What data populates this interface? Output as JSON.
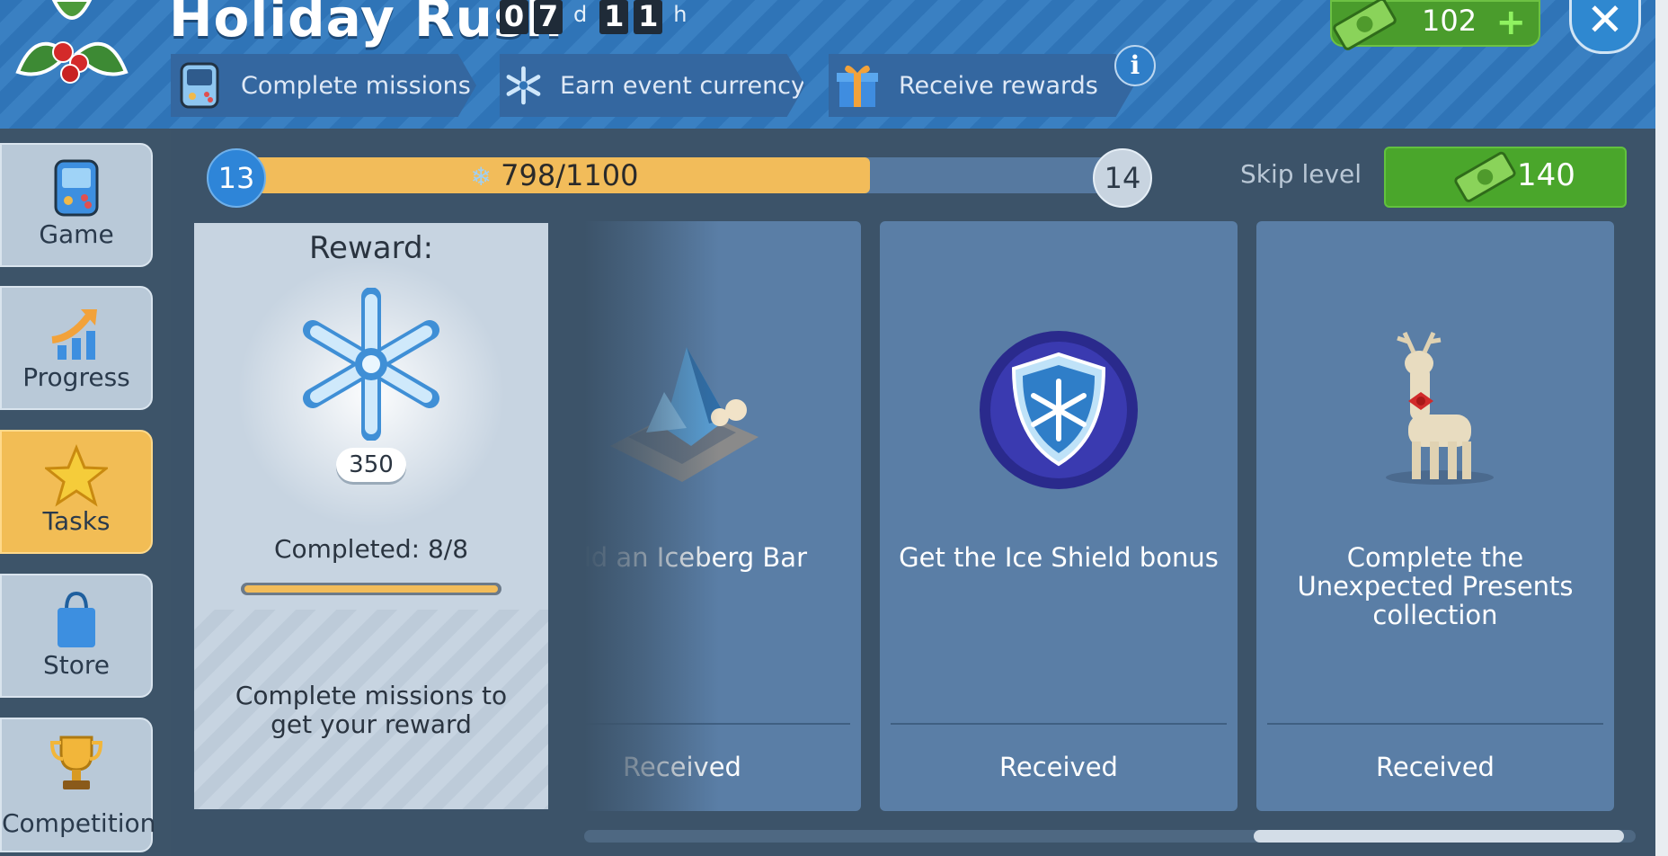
{
  "header": {
    "title": "Holiday Rush",
    "timer": {
      "days": [
        "0",
        "7"
      ],
      "days_unit": "d",
      "hours": [
        "1",
        "1"
      ],
      "hours_unit": "h"
    },
    "steps": [
      {
        "label": "Complete missions",
        "icon": "game-console-icon"
      },
      {
        "label": "Earn event currency",
        "icon": "snowflake-icon"
      },
      {
        "label": "Receive rewards",
        "icon": "gift-icon"
      }
    ],
    "info_label": "i",
    "currency": {
      "value": "102",
      "icon": "cash-icon",
      "add_label": "+"
    },
    "close_label": "✕"
  },
  "sidebar": {
    "items": [
      {
        "label": "Game",
        "icon": "game-console-icon"
      },
      {
        "label": "Progress",
        "icon": "chart-arrow-icon"
      },
      {
        "label": "Tasks",
        "icon": "star-icon",
        "active": true
      },
      {
        "label": "Store",
        "icon": "shopping-bag-icon"
      },
      {
        "label": "Competition",
        "icon": "trophy-icon"
      }
    ]
  },
  "progress": {
    "current_level": "13",
    "next_level": "14",
    "text": "798/1100",
    "value": 798,
    "max": 1100,
    "skip_label": "Skip level",
    "skip_cost": "140"
  },
  "reward": {
    "title": "Reward:",
    "amount": "350",
    "completed": "Completed: 8/8",
    "completed_fraction": 1.0,
    "hint": "Complete missions to get your reward"
  },
  "tasks": [
    {
      "name": "ild an Iceberg Bar",
      "status": "Received",
      "icon": "iceberg-bar-building-icon"
    },
    {
      "name": "Get the Ice Shield bonus",
      "status": "Received",
      "icon": "ice-shield-icon"
    },
    {
      "name": "Complete the Unexpected Presents collection",
      "status": "Received",
      "icon": "reindeer-icon"
    }
  ],
  "scroll": {
    "position": 0.64,
    "visible_fraction": 0.35
  },
  "colors": {
    "accent_gold": "#f2bc5a",
    "green": "#4aa62b",
    "blue": "#2f74b7"
  }
}
